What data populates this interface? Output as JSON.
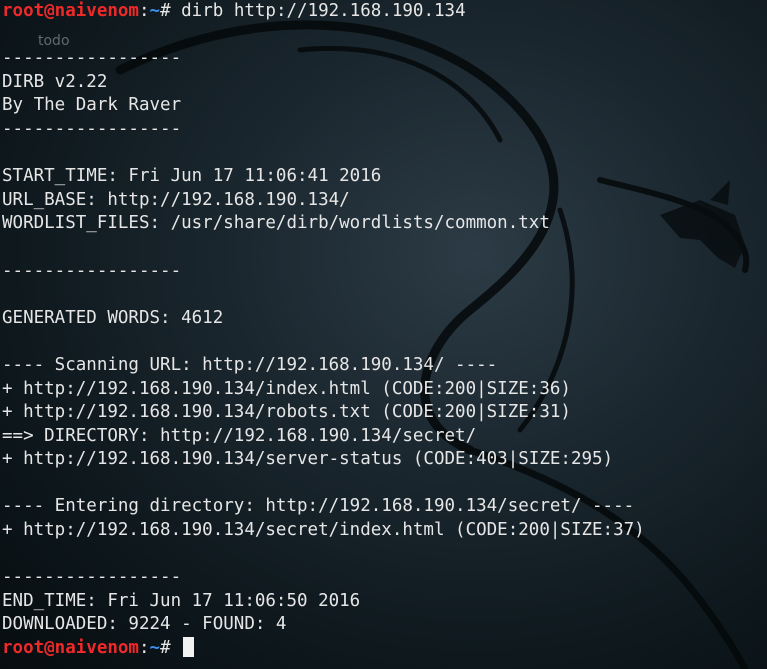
{
  "terminal": {
    "prompt": {
      "user_host": "root@naivenom",
      "colon": ":",
      "path": "~",
      "symbol": "#"
    },
    "command": " dirb http://192.168.190.134",
    "watermark_text": "todo",
    "output_lines": [
      "",
      "-----------------",
      "DIRB v2.22",
      "By The Dark Raver",
      "-----------------",
      "",
      "START_TIME: Fri Jun 17 11:06:41 2016",
      "URL_BASE: http://192.168.190.134/",
      "WORDLIST_FILES: /usr/share/dirb/wordlists/common.txt",
      "",
      "-----------------",
      "",
      "GENERATED WORDS: 4612",
      "",
      "---- Scanning URL: http://192.168.190.134/ ----",
      "+ http://192.168.190.134/index.html (CODE:200|SIZE:36)",
      "+ http://192.168.190.134/robots.txt (CODE:200|SIZE:31)",
      "==> DIRECTORY: http://192.168.190.134/secret/",
      "+ http://192.168.190.134/server-status (CODE:403|SIZE:295)",
      "",
      "---- Entering directory: http://192.168.190.134/secret/ ----",
      "+ http://192.168.190.134/secret/index.html (CODE:200|SIZE:37)",
      "",
      "-----------------",
      "END_TIME: Fri Jun 17 11:06:50 2016",
      "DOWNLOADED: 9224 - FOUND: 4"
    ],
    "final_command": " "
  },
  "colors": {
    "prompt_user": "#ef2929",
    "prompt_path": "#3b8eea",
    "text": "#e6e6e6"
  },
  "icons": {
    "wallpaper": "kali-dragon-icon"
  }
}
